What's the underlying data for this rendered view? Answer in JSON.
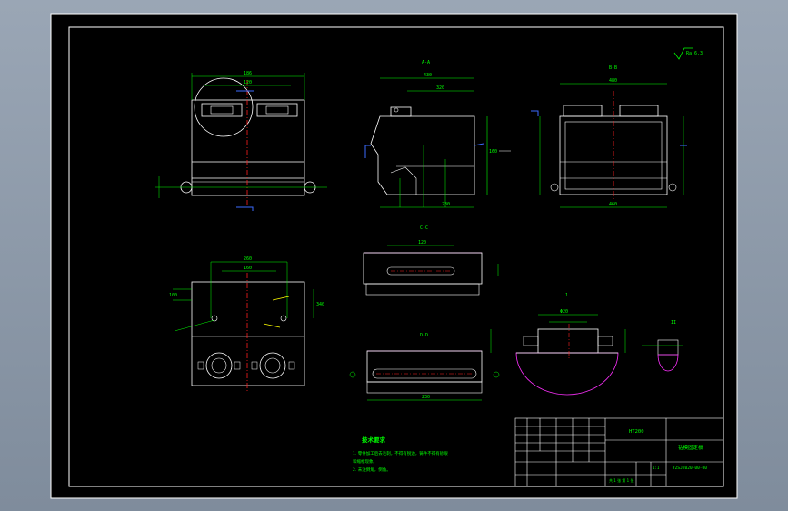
{
  "drawing": {
    "roughness_note": "Ra 6.3",
    "views": {
      "front_label": "A-A",
      "side_label": "B-B",
      "section_c": "C-C",
      "section_d": "D-D",
      "detail_1": "1",
      "detail_2": "II"
    },
    "dims": {
      "front_top_a": "186",
      "front_top_b": "120",
      "side_top_a": "430",
      "side_top_b": "320",
      "side_right": "160",
      "side_bottom": "230",
      "right_top": "480",
      "right_bottom": "460",
      "plan_top_a": "260",
      "plan_top_b": "160",
      "plan_top_c": "100",
      "plan_right": "340",
      "slot_c_top": "120",
      "slot_d_bottom": "230",
      "detail_dim": "Φ20"
    },
    "notes": {
      "title": "技术要求",
      "line1": "1. 零件加工后去毛刺，不得有锐边，铸件不得有砂眼",
      "line2": "   和缩松现象。",
      "line3": "2. 未注倒角，倒角。"
    },
    "title_block": {
      "material": "HT200",
      "part_name": "钻模固定板",
      "drawing_no": "YZSJ2020-00-00",
      "scale": "1:1",
      "sheet": "共 1 张 第 1 张"
    }
  }
}
